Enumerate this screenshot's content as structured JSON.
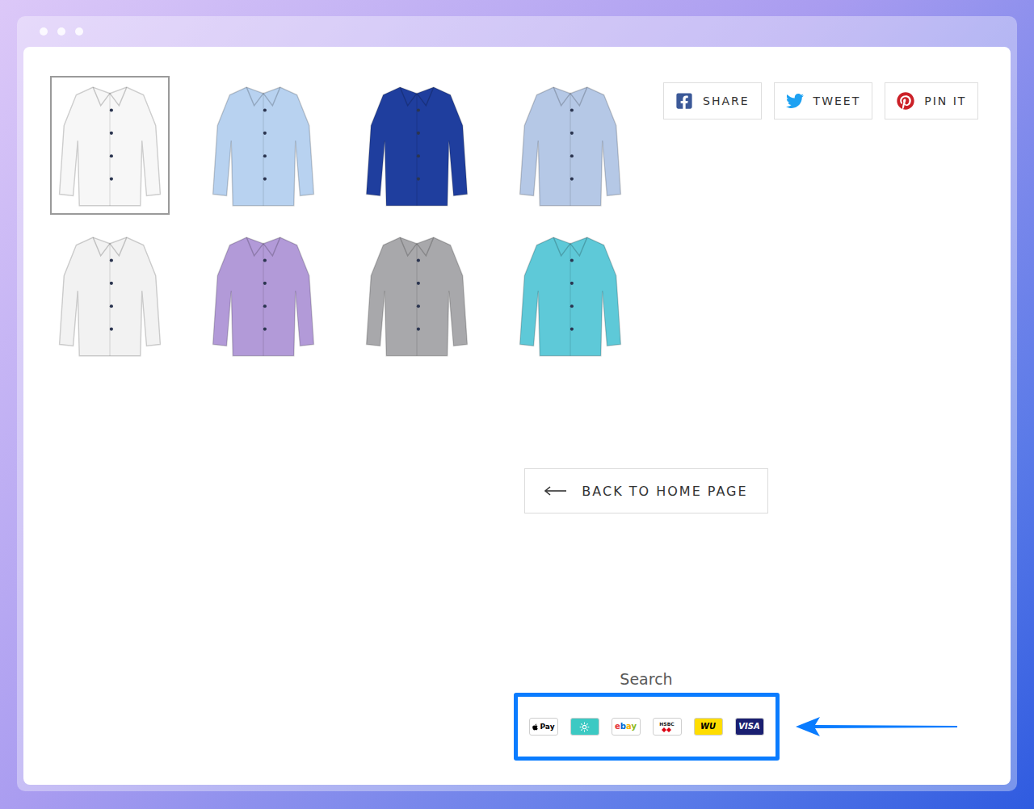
{
  "thumbnails": [
    {
      "color": "#f7f7f7",
      "selected": true
    },
    {
      "color": "#b8d2f0",
      "selected": false
    },
    {
      "color": "#1f3e9e",
      "selected": false
    },
    {
      "color": "#b5c8e6",
      "selected": false
    },
    {
      "color": "#f2f2f2",
      "selected": false
    },
    {
      "color": "#b29ad8",
      "selected": false
    },
    {
      "color": "#a8a8ab",
      "selected": false
    },
    {
      "color": "#5ec9d8",
      "selected": false
    }
  ],
  "share_buttons": [
    {
      "label": "SHARE",
      "network": "facebook",
      "color": "#3b5998"
    },
    {
      "label": "TWEET",
      "network": "twitter",
      "color": "#1da1f2"
    },
    {
      "label": "PIN IT",
      "network": "pinterest",
      "color": "#cb2027"
    }
  ],
  "back_button": {
    "label": "BACK TO HOME PAGE"
  },
  "search": {
    "label": "Search"
  },
  "payment_icons": [
    {
      "kind": "apple-pay",
      "label": "Pay",
      "color": "#ffffff"
    },
    {
      "kind": "sun",
      "color": "#3cc9c3"
    },
    {
      "kind": "ebay",
      "label": "ebay",
      "color": "#ffffff"
    },
    {
      "kind": "hsbc",
      "label": "HSBC",
      "color": "#ffffff"
    },
    {
      "kind": "wu",
      "label": "WU",
      "color": "#ffdd00"
    },
    {
      "kind": "visa",
      "label": "VISA",
      "color": "#1a1f71"
    }
  ]
}
